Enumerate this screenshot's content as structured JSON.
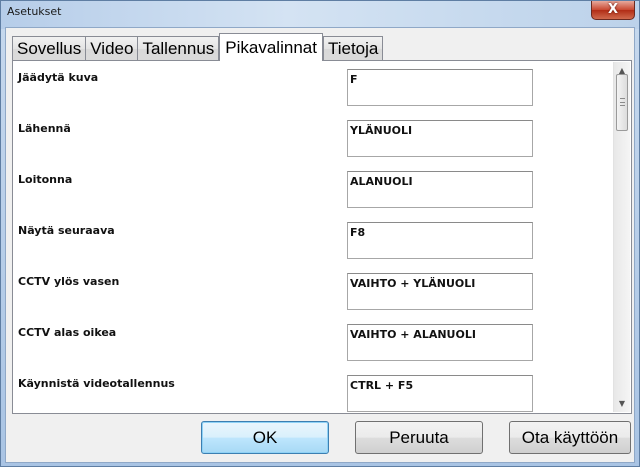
{
  "window": {
    "title": "Asetukset",
    "close_label": "X"
  },
  "tabs": [
    {
      "label": "Sovellus"
    },
    {
      "label": "Video"
    },
    {
      "label": "Tallennus"
    },
    {
      "label": "Pikavalinnat",
      "active": true
    },
    {
      "label": "Tietoja"
    }
  ],
  "shortcuts": [
    {
      "label": "Jäädytä kuva",
      "value": "F"
    },
    {
      "label": "Lähennä",
      "value": "YLÄNUOLI"
    },
    {
      "label": "Loitonna",
      "value": "ALANUOLI"
    },
    {
      "label": "Näytä seuraava",
      "value": "F8"
    },
    {
      "label": "CCTV ylös vasen",
      "value": "VAIHTO + YLÄNUOLI"
    },
    {
      "label": "CCTV alas oikea",
      "value": "VAIHTO + ALANUOLI"
    },
    {
      "label": "Käynnistä videotallennus",
      "value": "CTRL + F5"
    }
  ],
  "buttons": {
    "ok": "OK",
    "cancel": "Peruuta",
    "apply": "Ota käyttöön"
  },
  "scrollbar": {
    "up_icon": "scroll-up-arrow-icon",
    "down_icon": "scroll-down-arrow-icon"
  },
  "colors": {
    "accent": "#3c7fb1",
    "close": "#c8462f"
  }
}
